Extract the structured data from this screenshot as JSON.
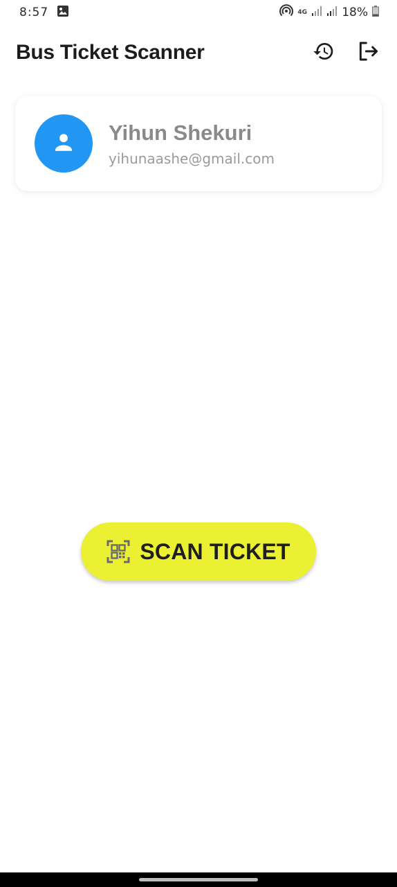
{
  "status_bar": {
    "time": "8:57",
    "network": "4G",
    "battery": "18%"
  },
  "app_bar": {
    "title": "Bus Ticket Scanner",
    "actions": [
      {
        "icon": "history-icon"
      },
      {
        "icon": "logout-icon"
      }
    ]
  },
  "profile": {
    "name": "Yihun Shekuri",
    "email": "yihunaashe@gmail.com",
    "avatar_color": "#2196f3"
  },
  "scan_button": {
    "label": "SCAN TICKET",
    "icon": "qr-code-scanner-icon",
    "color": "#ebf032"
  }
}
